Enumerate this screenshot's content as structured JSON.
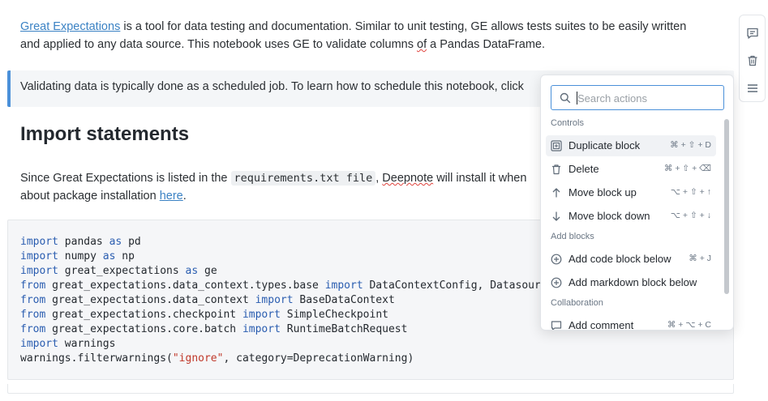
{
  "intro": {
    "link_text": "Great Expectations",
    "text_1": " is a tool for data testing and documentation. Similar to unit testing, GE allows tests suites to be easily written",
    "text_2a": "and applied to any data source. This notebook uses GE to validate columns ",
    "text_2b": "of",
    "text_2c": " a Pandas DataFrame."
  },
  "callout": {
    "text": "Validating data is typically done as a scheduled job. To learn how to schedule this notebook, click"
  },
  "section": {
    "heading": "Import statements",
    "text_1": "Since Great Expectations is listed in the ",
    "code": "requirements.txt file",
    "text_2": ", ",
    "squiggle": "Deepnote",
    "text_3": " will install it when",
    "text_4": "about package installation ",
    "link": "here",
    "text_5": "."
  },
  "code": {
    "line1": [
      "import",
      " pandas ",
      "as",
      " pd"
    ],
    "line2": [
      "import",
      " numpy ",
      "as",
      " np"
    ],
    "line3": [
      "import",
      " great_expectations ",
      "as",
      " ge"
    ],
    "line4": [
      "from",
      " great_expectations.data_context.types.base ",
      "import",
      " DataContextConfig, Datasour"
    ],
    "line5": [
      "from",
      " great_expectations.data_context ",
      "import",
      " BaseDataContext"
    ],
    "line6": [
      "from",
      " great_expectations.checkpoint ",
      "import",
      " SimpleCheckpoint"
    ],
    "line7": [
      "from",
      " great_expectations.core.batch ",
      "import",
      " RuntimeBatchRequest"
    ],
    "line8": [
      "import",
      " warnings"
    ],
    "line9": [
      "warnings.filterwarnings(",
      "\"ignore\"",
      ", category=DeprecationWarning)"
    ]
  },
  "menu": {
    "search_placeholder": "Search actions",
    "sections": {
      "controls": "Controls",
      "add_blocks": "Add blocks",
      "collaboration": "Collaboration"
    },
    "items": {
      "duplicate": {
        "label": "Duplicate block",
        "shortcut": "⌘ + ⇧ + D",
        "icon": "duplicate-icon"
      },
      "delete": {
        "label": "Delete",
        "shortcut": "⌘ + ⇧ + ⌫",
        "icon": "trash-icon"
      },
      "move_up": {
        "label": "Move block up",
        "shortcut": "⌥ + ⇧ + ↑",
        "icon": "arrow-up-icon"
      },
      "move_down": {
        "label": "Move block down",
        "shortcut": "⌥ + ⇧ + ↓",
        "icon": "arrow-down-icon"
      },
      "add_code": {
        "label": "Add code block below",
        "shortcut": "⌘ + J",
        "icon": "plus-circle-icon"
      },
      "add_markdown": {
        "label": "Add markdown block below",
        "shortcut": "",
        "icon": "plus-circle-icon"
      },
      "add_comment": {
        "label": "Add comment",
        "shortcut": "⌘ + ⌥ + C",
        "icon": "comment-icon"
      }
    }
  },
  "colors": {
    "accent": "#4a90d9",
    "link": "#3b82c4",
    "keyword": "#2a5db0",
    "string": "#c0392b"
  }
}
